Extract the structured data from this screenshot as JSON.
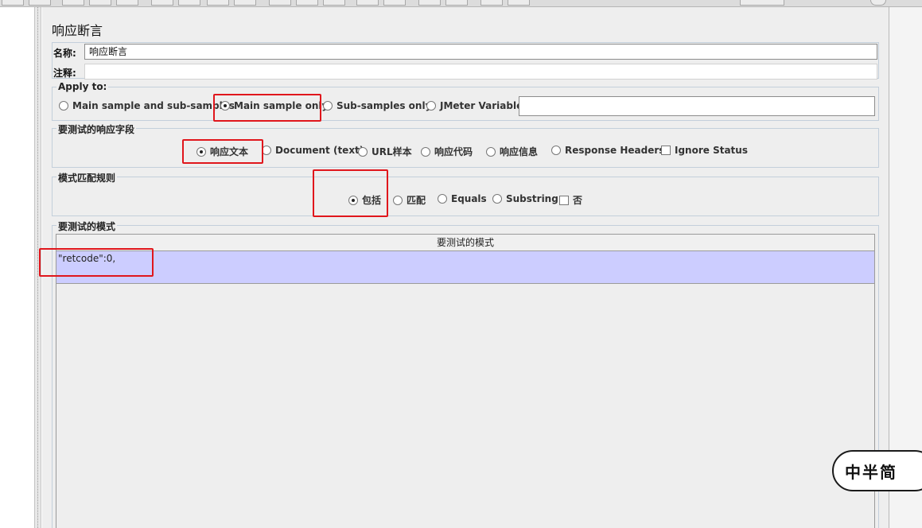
{
  "panel": {
    "title": "响应断言"
  },
  "fields": {
    "name_label": "名称:",
    "name_value": "响应断言",
    "comment_label": "注释:",
    "comment_value": ""
  },
  "apply_to": {
    "title": "Apply to:",
    "options": [
      "Main sample and sub-samples",
      "Main sample only",
      "Sub-samples only",
      "JMeter Variable"
    ],
    "selected": "Main sample only",
    "variable_value": ""
  },
  "response_field": {
    "title": "要测试的响应字段",
    "options": [
      "响应文本",
      "Document (text)",
      "URL样本",
      "响应代码",
      "响应信息",
      "Response Headers"
    ],
    "selected": "响应文本",
    "checkbox_label": "Ignore Status"
  },
  "pattern_rules": {
    "title": "模式匹配规则",
    "options": [
      "包括",
      "匹配",
      "Equals",
      "Substring"
    ],
    "selected": "包括",
    "checkbox_label": "否"
  },
  "patterns": {
    "title": "要测试的模式",
    "column_header": "要测试的模式",
    "rows": [
      "\"retcode\":0,"
    ]
  },
  "sticker": {
    "text": "中半简"
  }
}
